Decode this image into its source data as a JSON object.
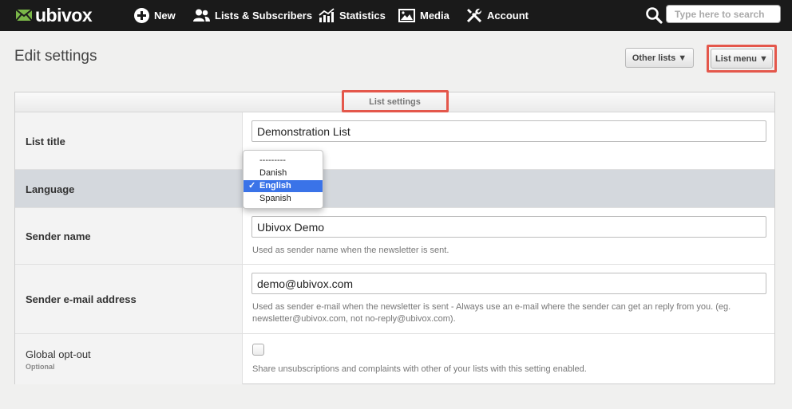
{
  "brand": {
    "name": "ubivox"
  },
  "nav": {
    "new": "New",
    "lists": "Lists & Subscribers",
    "statistics": "Statistics",
    "media": "Media",
    "account": "Account"
  },
  "search": {
    "placeholder": "Type here to search"
  },
  "header": {
    "title": "Edit settings",
    "other_lists": "Other lists ▼",
    "list_menu": "List menu ▼"
  },
  "panel": {
    "title": "List settings",
    "list_title": {
      "label": "List title",
      "value": "Demonstration List"
    },
    "language": {
      "label": "Language",
      "options": [
        "---------",
        "Danish",
        "English",
        "Spanish"
      ],
      "selected": "English",
      "check": "✓"
    },
    "sender_name": {
      "label": "Sender name",
      "value": "Ubivox Demo",
      "hint": "Used as sender name when the newsletter is sent."
    },
    "sender_email": {
      "label": "Sender e-mail address",
      "value": "demo@ubivox.com",
      "hint_line1": "Used as sender e-mail when the newsletter is sent - Always use an e-mail where the sender can get an reply from you. (eg.",
      "hint_line2": "newsletter@ubivox.com, not no-reply@ubivox.com)."
    },
    "global_optout": {
      "label": "Global opt-out",
      "sublabel": "Optional",
      "checked": false,
      "hint": "Share unsubscriptions and complaints with other of your lists with this setting enabled."
    }
  },
  "colors": {
    "topbar": "#1a1a1a",
    "brand_green": "#7ab648",
    "highlight": "#e4574b",
    "selected": "#3a73e8"
  }
}
